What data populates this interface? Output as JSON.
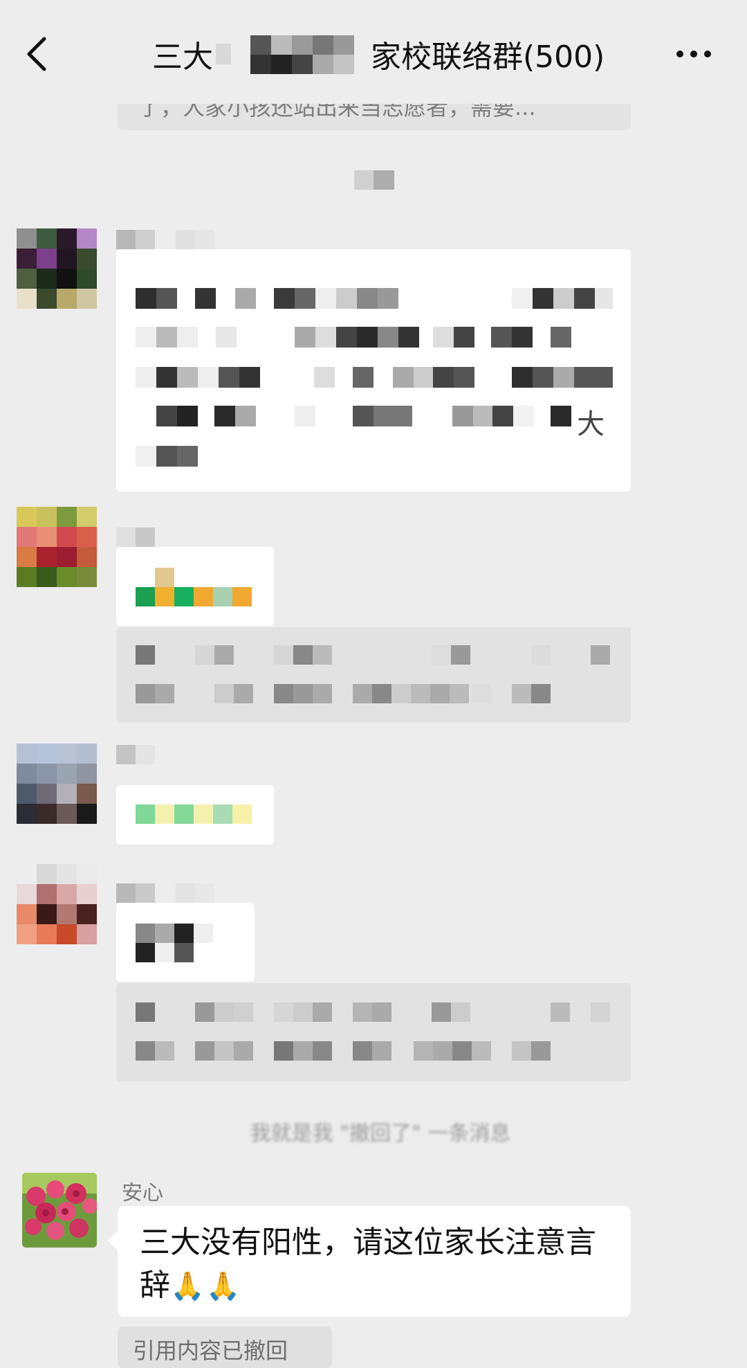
{
  "header": {
    "title_prefix": "三大",
    "title_suffix": "家校联络群(500)",
    "back_icon": "chevron-left-icon",
    "more_icon": "more-dots-icon"
  },
  "messages": {
    "previous_quote_text": "了，人家小孩还站出来当志愿者，需要...",
    "blurred_char": "大",
    "recall_notice": "我就是我 \"撤回了\" 一条消息",
    "final_sender_name": "安心",
    "final_text": "三大没有阳性，请这位家长注意言辞",
    "final_emoji": "🙏🙏",
    "recalled_quote_text": "引用内容已撤回"
  },
  "colors": {
    "background": "#ededed",
    "bubble": "#ffffff",
    "quote_bg": "#e2e2e2"
  }
}
